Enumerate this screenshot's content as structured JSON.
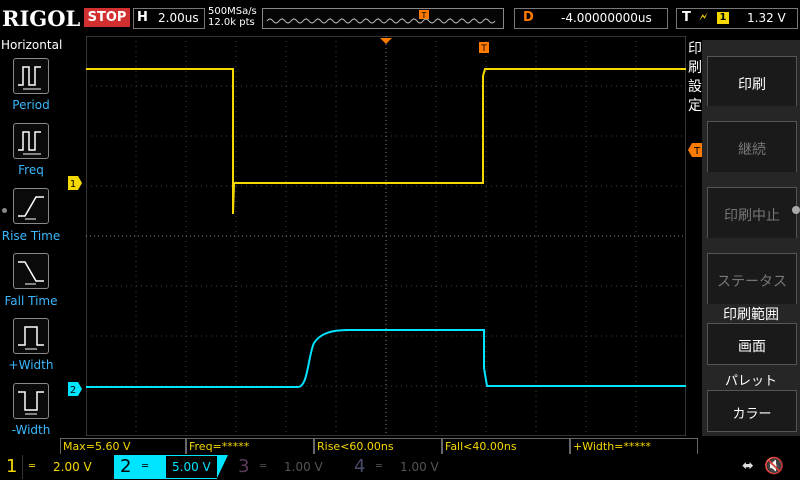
{
  "header": {
    "brand": "RIGOL",
    "run_state": "STOP",
    "horizontal": {
      "key": "H",
      "value": "2.00us"
    },
    "sample_rate": "500MSa/s",
    "memory_depth": "12.0k pts",
    "delay": {
      "key": "D",
      "value": "-4.00000000us"
    },
    "trigger": {
      "key": "T",
      "edge_icon": "rising-edge-icon",
      "source": "1",
      "level": "1.32 V"
    }
  },
  "left_menu": {
    "title": "Horizontal",
    "items": [
      {
        "label": "Period",
        "icon": "period-icon"
      },
      {
        "label": "Freq",
        "icon": "frequency-icon"
      },
      {
        "label": "Rise Time",
        "icon": "rise-time-icon"
      },
      {
        "label": "Fall Time",
        "icon": "fall-time-icon"
      },
      {
        "label": "+Width",
        "icon": "positive-width-icon"
      },
      {
        "label": "-Width",
        "icon": "negative-width-icon"
      }
    ]
  },
  "markers": {
    "ch1": "1",
    "ch2": "2",
    "trigger_top": "T",
    "trigger_level": "T"
  },
  "right_menu": {
    "title": "印刷設定",
    "print_button": "印刷",
    "continue_button": "継続",
    "abort_button": "印刷中止",
    "status_button": "ステータス",
    "range_label": "印刷範囲",
    "range_value": "画面",
    "palette_label": "パレット",
    "palette_value": "カラー"
  },
  "measurements": {
    "max": "Max=5.60 V",
    "freq": "Freq=*****",
    "rise": "Rise<60.00ns",
    "fall": "Fall<40.00ns",
    "pwidth": "+Width=*****"
  },
  "channels": [
    {
      "num": "1",
      "scale": "2.00 V",
      "color": "#f5d800",
      "active": true
    },
    {
      "num": "2",
      "scale": "5.00 V",
      "color": "#00e5ff",
      "active": true
    },
    {
      "num": "3",
      "scale": "1.00 V",
      "color": "#c040c0",
      "active": false
    },
    {
      "num": "4",
      "scale": "1.00 V",
      "color": "#3a6aff",
      "active": false
    }
  ],
  "colors": {
    "ch1": "#f5d800",
    "ch2": "#00e5ff",
    "trigger": "#ff7a00",
    "menu_label": "#3ab8ff",
    "stop": "#d23030"
  }
}
